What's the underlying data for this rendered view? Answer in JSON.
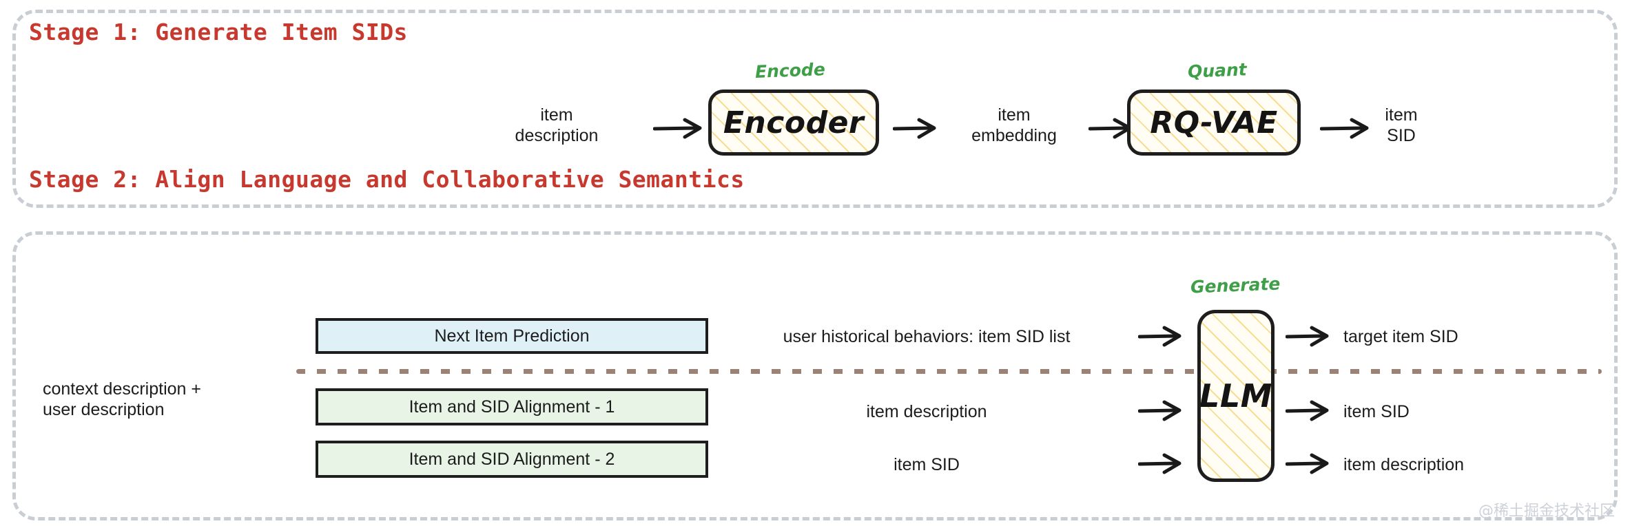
{
  "figure": {
    "watermark": "@稀土掘金技术社区",
    "colors": {
      "title_red": "#c7382f",
      "annotation_green": "#3f9f48",
      "hatch_yellow": "#f7dc92",
      "divider_brown": "#9c8275",
      "stage_border_gray": "#c8ced4",
      "task_blue": "#dff0f7",
      "task_green": "#e8f5e6",
      "box_border_black": "#1e1e1e"
    }
  },
  "stage1": {
    "title": "Stage 1: Generate Item SIDs",
    "input_label": "item\ndescription",
    "encoder_annotation": "Encode",
    "encoder_label": "Encoder",
    "middle_label": "item\nembedding",
    "quant_annotation": "Quant",
    "quant_label": "RQ-VAE",
    "output_label": "item\nSID"
  },
  "stage2": {
    "title": "Stage 2: Align Language and Collaborative Semantics",
    "side_label": "context description +\nuser description",
    "tasks": [
      {
        "label": "Next Item Prediction",
        "style": "blue"
      },
      {
        "label": "Item and SID Alignment - 1",
        "style": "green"
      },
      {
        "label": "Item and SID Alignment - 2",
        "style": "green"
      }
    ],
    "inputs": [
      "user historical behaviors: item SID list",
      "item description",
      "item SID"
    ],
    "llm_annotation": "Generate",
    "llm_label": "LLM",
    "outputs": [
      "target item SID",
      "item SID",
      "item description"
    ]
  }
}
